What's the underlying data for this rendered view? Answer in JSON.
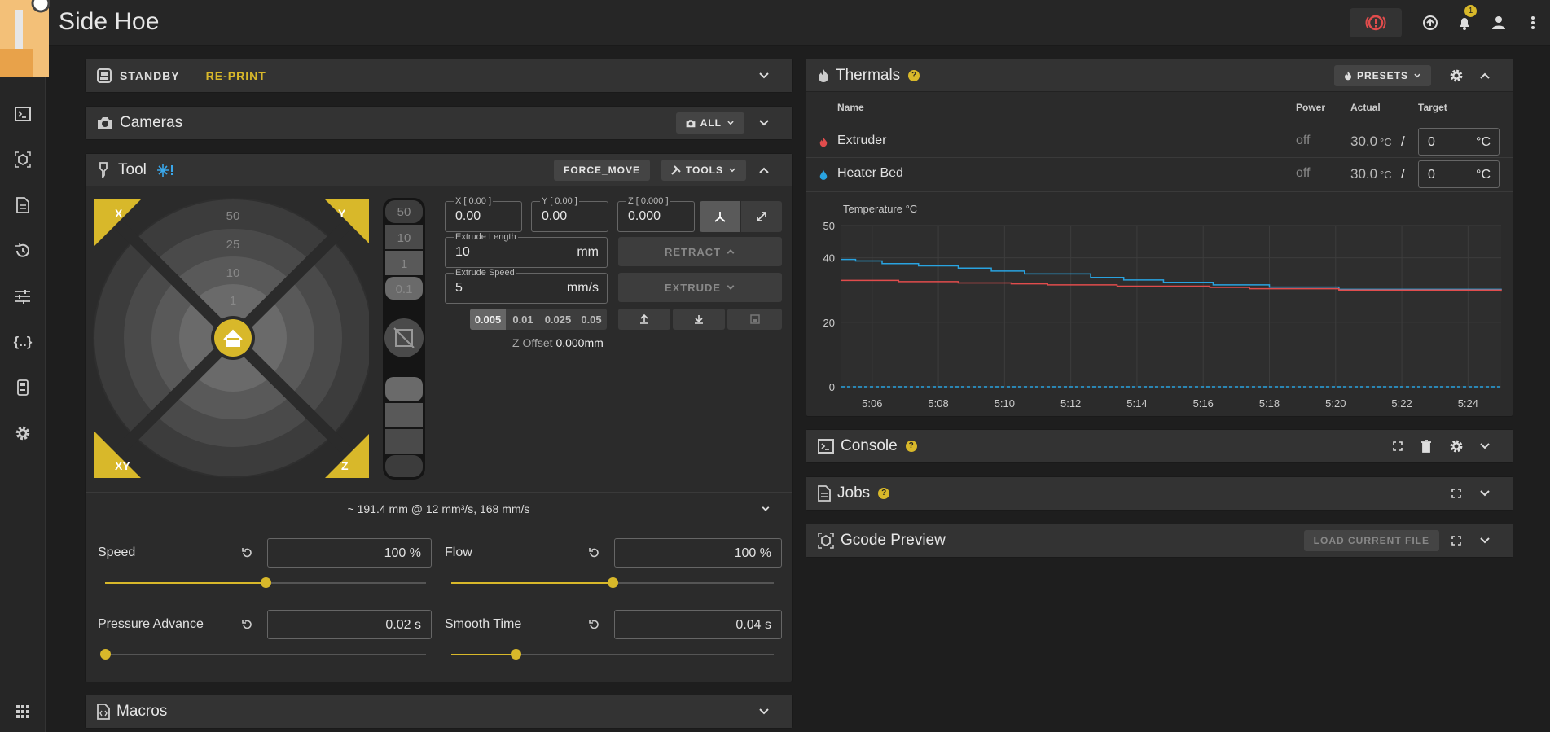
{
  "app": {
    "title": "Side Hoe",
    "notification_count": "1"
  },
  "status": {
    "state": "STANDBY",
    "reprint": "RE-PRINT"
  },
  "cameras": {
    "title": "Cameras",
    "filter": "ALL"
  },
  "tool": {
    "title": "Tool",
    "force_move": "FORCE_MOVE",
    "tools": "TOOLS",
    "jog": {
      "x": "X",
      "y": "Y",
      "xy": "XY",
      "z": "Z",
      "rings": [
        "50",
        "25",
        "10",
        "1"
      ],
      "z_steps": [
        "50",
        "10",
        "1",
        "0.1"
      ]
    },
    "coords": {
      "x_label": "X [ 0.00 ]",
      "x_val": "0.00",
      "y_label": "Y [ 0.00 ]",
      "y_val": "0.00",
      "z_label": "Z [ 0.000 ]",
      "z_val": "0.000"
    },
    "extrude_length": {
      "label": "Extrude Length",
      "value": "10",
      "unit": "mm"
    },
    "extrude_speed": {
      "label": "Extrude Speed",
      "value": "5",
      "unit": "mm/s"
    },
    "retract": "RETRACT",
    "extrude": "EXTRUDE",
    "z_steps_small": [
      "0.005",
      "0.01",
      "0.025",
      "0.05"
    ],
    "z_offset_label": "Z Offset",
    "z_offset_value": "0.000mm",
    "summary": "~ 191.4 mm @ 12 mm³/s, 168 mm/s",
    "speed": {
      "label": "Speed",
      "value": "100 %",
      "level": 0.5
    },
    "flow": {
      "label": "Flow",
      "value": "100 %",
      "level": 0.5
    },
    "pressure_advance": {
      "label": "Pressure Advance",
      "value": "0.02 s",
      "level": 0.0
    },
    "smooth_time": {
      "label": "Smooth Time",
      "value": "0.04 s",
      "level": 0.2
    }
  },
  "macros": {
    "title": "Macros"
  },
  "thermals": {
    "title": "Thermals",
    "presets": "PRESETS",
    "headers": {
      "name": "Name",
      "power": "Power",
      "actual": "Actual",
      "target": "Target"
    },
    "rows": [
      {
        "name": "Extruder",
        "power": "off",
        "actual": "30.0",
        "unit": "°C",
        "slash": "/",
        "target": "0",
        "target_unit": "°C"
      },
      {
        "name": "Heater Bed",
        "power": "off",
        "actual": "30.0",
        "unit": "°C",
        "slash": "/",
        "target": "0",
        "target_unit": "°C"
      }
    ]
  },
  "chart_data": {
    "type": "line",
    "ylabel": "Temperature °C",
    "yticks": [
      "50",
      "40",
      "20",
      "0"
    ],
    "xticks": [
      "5:06",
      "5:08",
      "5:10",
      "5:12",
      "5:14",
      "5:16",
      "5:18",
      "5:20",
      "5:22",
      "5:24"
    ],
    "ylim": [
      0,
      50
    ],
    "xlim": [
      5.07,
      25.0
    ],
    "series": [
      {
        "color": "#29a3e0",
        "x": [
          5.07,
          5.5,
          6.3,
          7.4,
          8.6,
          9.6,
          10.6,
          12.6,
          13.6,
          14.8,
          16.3,
          18.0,
          20.1,
          25.0
        ],
        "values": [
          39.5,
          39.0,
          38.2,
          37.5,
          36.8,
          35.9,
          35.0,
          33.9,
          33.1,
          32.4,
          31.6,
          30.9,
          30.2,
          30.0
        ]
      },
      {
        "color": "#e14c4c",
        "x": [
          5.07,
          6.8,
          8.6,
          10.2,
          11.3,
          13.4,
          16.2,
          17.4,
          20.1,
          25.0
        ],
        "values": [
          33.0,
          32.6,
          32.2,
          31.9,
          31.6,
          31.2,
          30.8,
          30.4,
          30.0,
          29.5
        ]
      },
      {
        "color": "#29a3e0",
        "dashed": true,
        "x": [
          5.07,
          25.0
        ],
        "values": [
          0,
          0
        ]
      }
    ]
  },
  "console": {
    "title": "Console"
  },
  "jobs": {
    "title": "Jobs"
  },
  "gcode": {
    "title": "Gcode Preview",
    "load": "LOAD CURRENT FILE"
  },
  "colors": {
    "accent": "#d8b82a",
    "extruder": "#e14c4c",
    "bed": "#29a3e0"
  }
}
